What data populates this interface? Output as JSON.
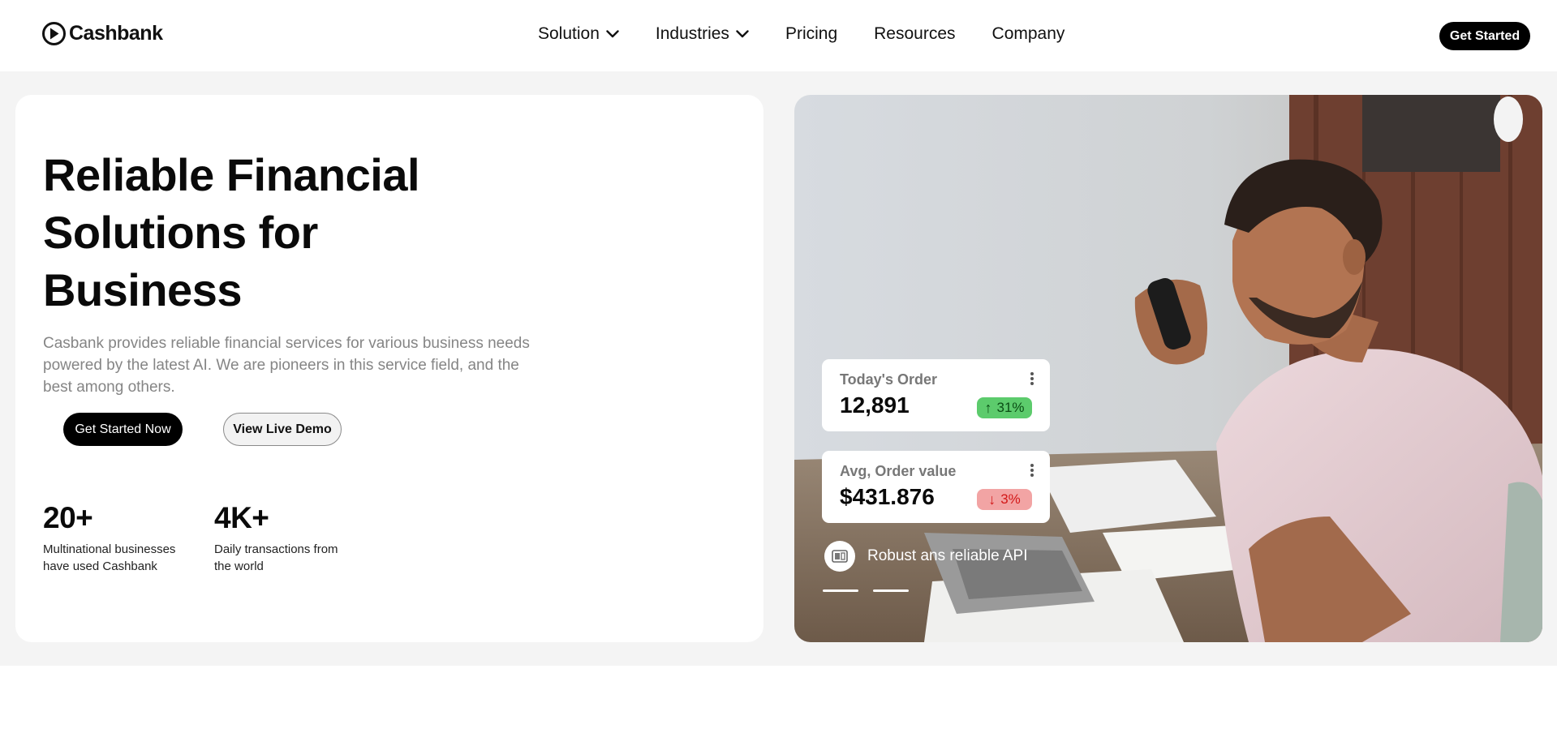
{
  "brand": {
    "name": "Cashbank"
  },
  "nav": {
    "items": [
      {
        "label": "Solution",
        "has_dropdown": true
      },
      {
        "label": "Industries",
        "has_dropdown": true
      },
      {
        "label": "Pricing",
        "has_dropdown": false
      },
      {
        "label": "Resources",
        "has_dropdown": false
      },
      {
        "label": "Company",
        "has_dropdown": false
      }
    ],
    "cta_label": "Get Started"
  },
  "hero": {
    "title_lines": [
      "Reliable Financial",
      "Solutions for",
      "Business"
    ],
    "description": "Casbank provides reliable financial services for various business needs powered by the latest AI. We are pioneers in this service field, and the best among others.",
    "primary_cta": "Get Started Now",
    "secondary_cta": "View Live Demo",
    "stats": [
      {
        "value": "20+",
        "label_lines": [
          "Multinational businesses",
          "have used Cashbank"
        ]
      },
      {
        "value": "4K+",
        "label_lines": [
          "Daily transactions from",
          "the world"
        ]
      }
    ]
  },
  "showcase": {
    "widgets": [
      {
        "title": "Today's Order",
        "value": "12,891",
        "change": "31%",
        "direction": "up",
        "badge_color": "#5ccb6c"
      },
      {
        "title": "Avg, Order value",
        "value": "$431.876",
        "change": "3%",
        "direction": "down",
        "badge_color": "#f2a4a4"
      }
    ],
    "feature_label": "Robust ans reliable API",
    "feature_icon": "api-document-icon",
    "carousel_slides": 2
  },
  "colors": {
    "primary": "#000000",
    "page_bg": "#f4f4f4",
    "card_bg": "#ffffff",
    "muted_text": "#858585",
    "up": "#5ccb6c",
    "down": "#f2a4a4"
  }
}
